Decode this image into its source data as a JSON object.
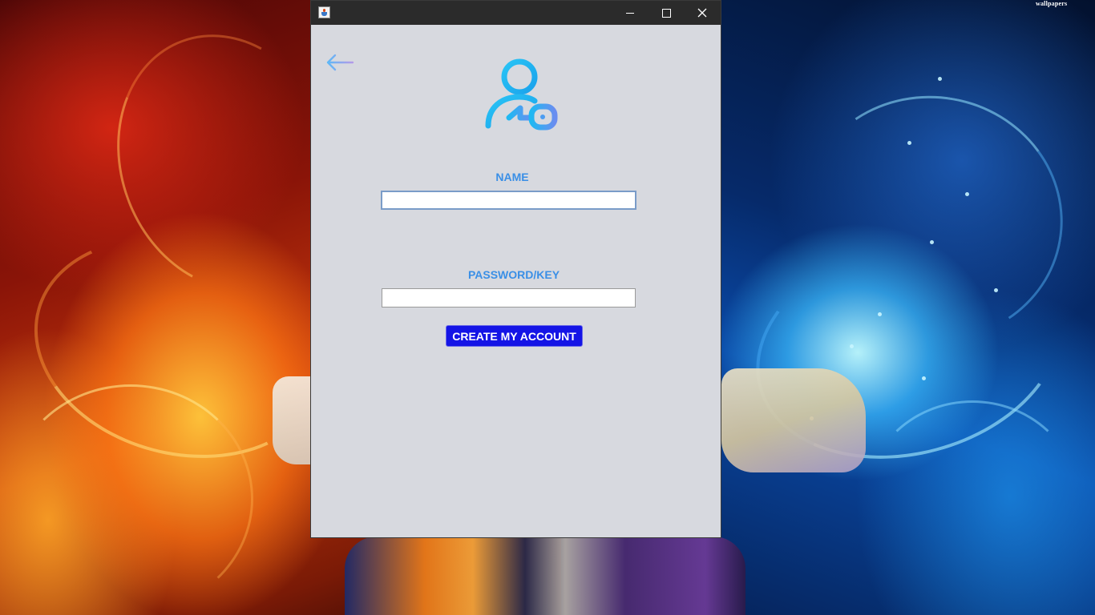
{
  "window": {
    "title": "",
    "app_icon": "java-cup-icon",
    "controls": {
      "minimize": "minimize-icon",
      "maximize": "maximize-icon",
      "close": "close-icon"
    }
  },
  "form": {
    "back_icon": "arrow-left-icon",
    "header_icon": "user-key-icon",
    "name_label": "NAME",
    "name_value": "",
    "password_label": "PASSWORD/KEY",
    "password_value": "",
    "submit_label": "CREATE MY ACCOUNT"
  },
  "desktop": {
    "watermark": "wallpapers"
  },
  "colors": {
    "label": "#3a8fe6",
    "button": "#1414e6",
    "window_bg": "#d7d9df",
    "titlebar": "#2b2b2b"
  }
}
